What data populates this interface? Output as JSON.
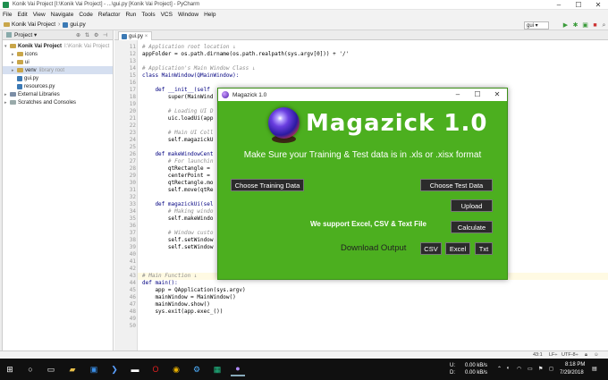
{
  "window": {
    "title": "Konik Vai Project [I:\\Konik Vai Project] - ...\\gui.py [Konik Vai Project] - PyCharm"
  },
  "menu": [
    "File",
    "Edit",
    "View",
    "Navigate",
    "Code",
    "Refactor",
    "Run",
    "Tools",
    "VCS",
    "Window",
    "Help"
  ],
  "breadcrumb": {
    "project": "Konik Vai Project",
    "file": "gui.py"
  },
  "run_config": "gui",
  "project_panel": {
    "header": "Project",
    "items": [
      {
        "label": "Konik Vai Project",
        "extra": "I:\\Konik Vai Project",
        "level": 0,
        "expanded": true,
        "type": "folder"
      },
      {
        "label": "icons",
        "level": 1,
        "type": "folder"
      },
      {
        "label": "ui",
        "level": 1,
        "type": "folder"
      },
      {
        "label": "venv",
        "extra": "library root",
        "level": 1,
        "type": "folder"
      },
      {
        "label": "gui.py",
        "level": 1,
        "type": "py"
      },
      {
        "label": "resources.py",
        "level": 1,
        "type": "py"
      },
      {
        "label": "External Libraries",
        "level": 0,
        "type": "lib"
      },
      {
        "label": "Scratches and Consoles",
        "level": 0,
        "type": "scratch"
      }
    ]
  },
  "editor_tab": "gui.py",
  "code_lines": [
    {
      "n": "11",
      "t": "# Application root location ↓",
      "c": "cmt"
    },
    {
      "n": "12",
      "t": "appFolder = os.path.dirname(os.path.realpath(sys.argv[0])) + '/'",
      "c": ""
    },
    {
      "n": "13",
      "t": "",
      "c": ""
    },
    {
      "n": "14",
      "t": "# Application's Main Window Class ↓",
      "c": "cmt"
    },
    {
      "n": "15",
      "t": "class MainWindow(QMainWindow):",
      "c": "kw"
    },
    {
      "n": "16",
      "t": "",
      "c": ""
    },
    {
      "n": "17",
      "t": "    def __init__(self",
      "c": "kw"
    },
    {
      "n": "18",
      "t": "        super(MainWind",
      "c": ""
    },
    {
      "n": "19",
      "t": "",
      "c": ""
    },
    {
      "n": "20",
      "t": "        # Loading UI D",
      "c": "cmt"
    },
    {
      "n": "21",
      "t": "        uic.loadUi(app",
      "c": ""
    },
    {
      "n": "22",
      "t": "",
      "c": ""
    },
    {
      "n": "23",
      "t": "        # Main UI Coll",
      "c": "cmt"
    },
    {
      "n": "24",
      "t": "        self.magazickU",
      "c": ""
    },
    {
      "n": "25",
      "t": "",
      "c": ""
    },
    {
      "n": "26",
      "t": "    def makeWindowCent",
      "c": "kw"
    },
    {
      "n": "27",
      "t": "        # For launchin",
      "c": "cmt"
    },
    {
      "n": "28",
      "t": "        qtRectangle = ",
      "c": ""
    },
    {
      "n": "29",
      "t": "        centerPoint = ",
      "c": ""
    },
    {
      "n": "30",
      "t": "        qtRectangle.mo",
      "c": ""
    },
    {
      "n": "31",
      "t": "        self.move(qtRe",
      "c": ""
    },
    {
      "n": "32",
      "t": "",
      "c": ""
    },
    {
      "n": "33",
      "t": "    def magazickUi(sel",
      "c": "kw"
    },
    {
      "n": "34",
      "t": "        # Making windo",
      "c": "cmt"
    },
    {
      "n": "35",
      "t": "        self.makeWindo",
      "c": ""
    },
    {
      "n": "36",
      "t": "",
      "c": ""
    },
    {
      "n": "37",
      "t": "        # Window custo",
      "c": "cmt"
    },
    {
      "n": "38",
      "t": "        self.setWindow",
      "c": ""
    },
    {
      "n": "39",
      "t": "        self.setWindow",
      "c": ""
    },
    {
      "n": "40",
      "t": "",
      "c": ""
    },
    {
      "n": "41",
      "t": "",
      "c": ""
    },
    {
      "n": "42",
      "t": "",
      "c": ""
    },
    {
      "n": "43",
      "t": "# Main Function ↓",
      "c": "cmt"
    },
    {
      "n": "44",
      "t": "def main():",
      "c": "kw"
    },
    {
      "n": "45",
      "t": "    app = QApplication(sys.argv)",
      "c": ""
    },
    {
      "n": "46",
      "t": "    mainWindow = MainWindow()",
      "c": ""
    },
    {
      "n": "47",
      "t": "    mainWindow.show()",
      "c": ""
    },
    {
      "n": "48",
      "t": "    sys.exit(app.exec_())",
      "c": ""
    },
    {
      "n": "49",
      "t": "",
      "c": ""
    },
    {
      "n": "50",
      "t": "",
      "c": ""
    }
  ],
  "status": {
    "pos": "43:1",
    "lf": "LF÷",
    "enc": "UTF-8÷"
  },
  "dialog": {
    "title": "Magazick 1.0",
    "brand": "Magazick 1.0",
    "subtitle": "Make Sure your Training & Test data is in .xls or .xisx format",
    "choose_training": "Choose Training Data",
    "choose_test": "Choose Test Data",
    "upload": "Upload",
    "support": "We support Excel, CSV & Text File",
    "calculate": "Calculate",
    "download_label": "Download Output",
    "csv": "CSV",
    "excel": "Excel",
    "txt": "Txt"
  },
  "taskbar": {
    "time": "8:18 PM",
    "date": "7/29/2018",
    "net_up": "0.00 kB/s",
    "net_down": "0.00 kB/s",
    "u": "U:",
    "d": "D:"
  },
  "colors": {
    "dialog_bg": "#4caf1f",
    "button_bg": "#2b2b2b",
    "taskbar": "#101010"
  }
}
